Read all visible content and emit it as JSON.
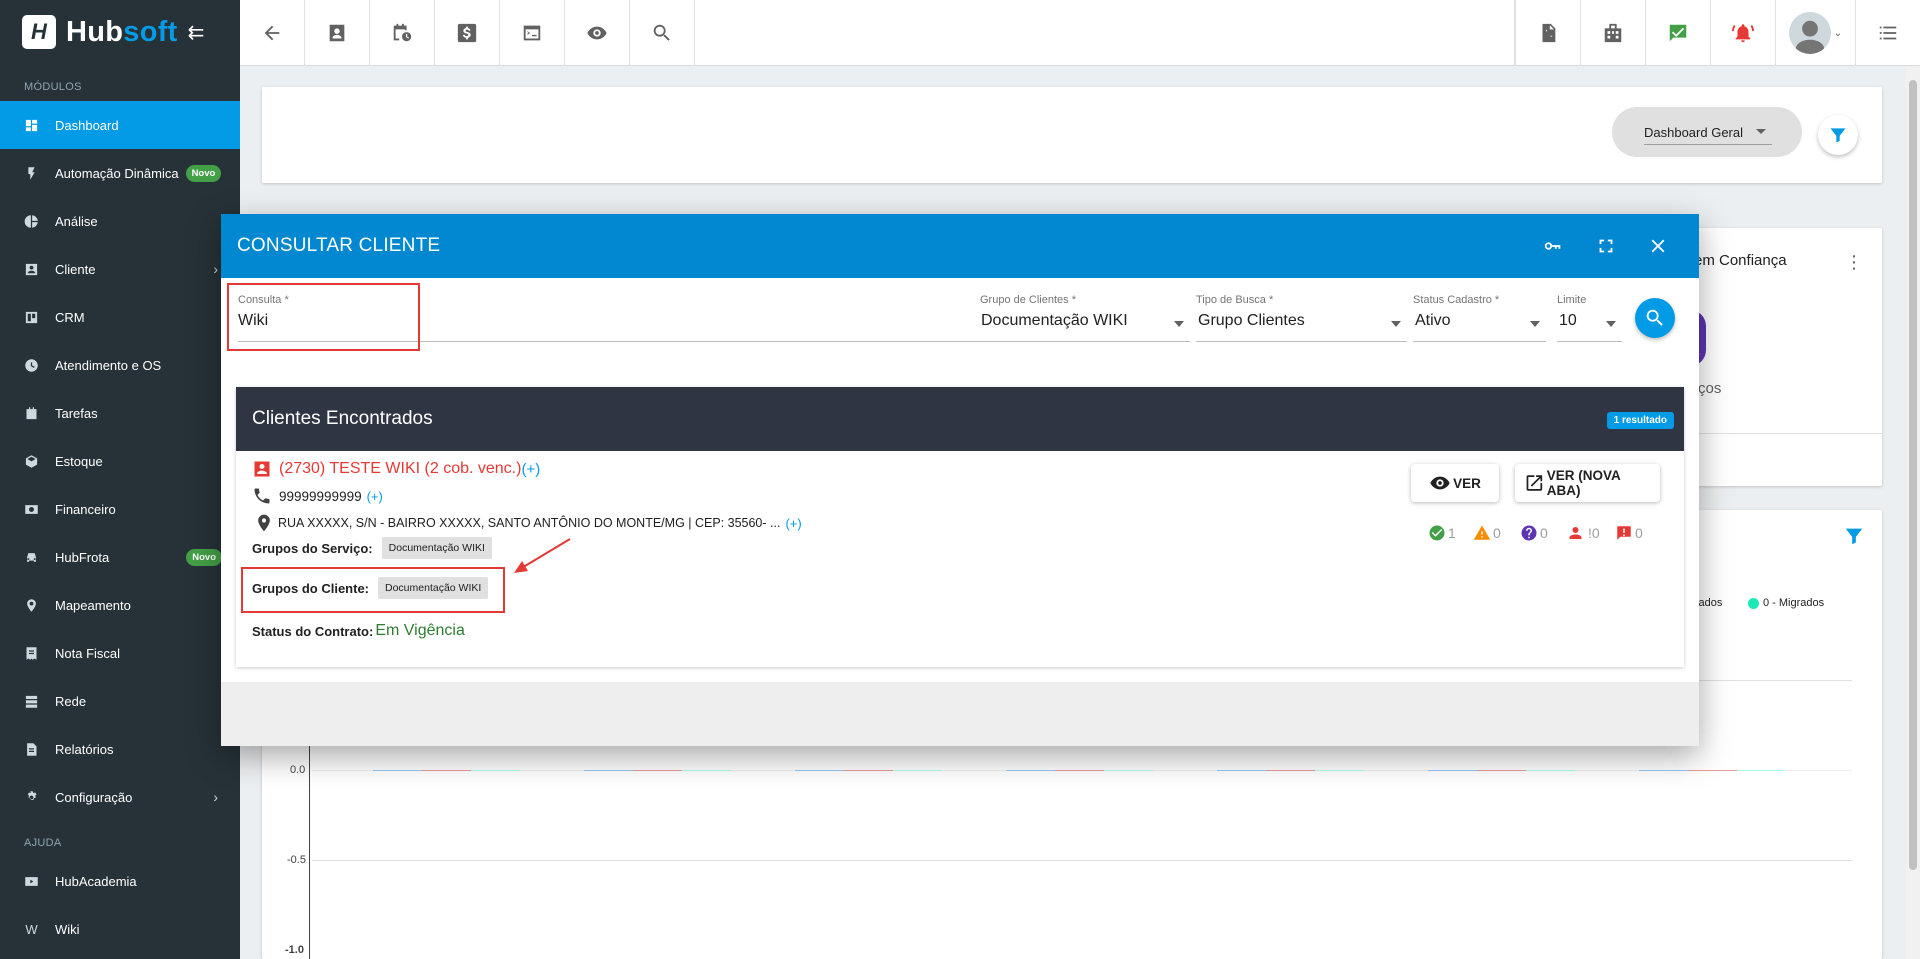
{
  "brand": {
    "name_main": "Hub",
    "name_accent": "soft",
    "logo_letter": "H"
  },
  "sidebar": {
    "section_modules": "MÓDULOS",
    "section_help": "AJUDA",
    "items": [
      {
        "label": "Dashboard",
        "icon": "dashboard-icon",
        "active": true
      },
      {
        "label": "Automação Dinâmica",
        "icon": "automation-icon",
        "badge": "Novo"
      },
      {
        "label": "Análise",
        "icon": "pie-chart-icon"
      },
      {
        "label": "Cliente",
        "icon": "client-icon",
        "has_children": true
      },
      {
        "label": "CRM",
        "icon": "trello-icon"
      },
      {
        "label": "Atendimento e OS",
        "icon": "clock-calendar-icon"
      },
      {
        "label": "Tarefas",
        "icon": "tasks-icon"
      },
      {
        "label": "Estoque",
        "icon": "box-icon"
      },
      {
        "label": "Financeiro",
        "icon": "money-icon"
      },
      {
        "label": "HubFrota",
        "icon": "car-icon",
        "badge": "Novo"
      },
      {
        "label": "Mapeamento",
        "icon": "pin-person-icon"
      },
      {
        "label": "Nota Fiscal",
        "icon": "receipt-icon"
      },
      {
        "label": "Rede",
        "icon": "server-icon"
      },
      {
        "label": "Relatórios",
        "icon": "report-icon"
      },
      {
        "label": "Configuração",
        "icon": "gear-icon",
        "has_children": true
      }
    ],
    "help_items": [
      {
        "label": "HubAcademia",
        "icon": "youtube-icon"
      },
      {
        "label": "Wiki",
        "icon": "wiki-icon"
      }
    ]
  },
  "dashboard": {
    "selector_value": "Dashboard Geral",
    "background_card_title": "em Confiança",
    "background_card_fragment": "ços",
    "legend_left": "elados",
    "legend_right": "0 - Migrados",
    "y_axis_ticks": [
      "0.0",
      "-0.5",
      "-1.0"
    ]
  },
  "modal": {
    "title": "CONSULTAR CLIENTE",
    "consulta_label": "Consulta *",
    "consulta_value": "Wiki",
    "grupo_label": "Grupo de Clientes *",
    "grupo_value": "Documentação WIKI",
    "tipo_label": "Tipo de Busca *",
    "tipo_value": "Grupo Clientes",
    "status_label": "Status Cadastro *",
    "status_value": "Ativo",
    "limite_label": "Limite",
    "limite_value": "10"
  },
  "results": {
    "title": "Clientes Encontrados",
    "count_label": "1 resultado",
    "client": {
      "name": "(2730) TESTE WIKI (2 cob. venc.)",
      "name_plus": "(+)",
      "phone": "99999999999",
      "phone_plus": "(+)",
      "address": "RUA XXXXX, S/N - BAIRRO XXXXX, SANTO ANTÔNIO DO MONTE/MG | CEP: 35560- ...",
      "address_plus": "(+)",
      "service_groups_label": "Grupos do Serviço:",
      "service_groups_chip": "Documentação WIKI",
      "client_groups_label": "Grupos do Cliente:",
      "client_groups_chip": "Documentação WIKI",
      "contract_status_label": "Status do Contrato:",
      "contract_status_value": "Em Vigência"
    },
    "buttons": {
      "view": "VER",
      "view_new_tab": "VER (NOVA ABA)"
    },
    "stats": {
      "ok": "1",
      "warning": "0",
      "question": "0",
      "person": "!0",
      "alert": "0"
    },
    "colors": {
      "ok": "#43a047",
      "warning": "#fb8c00",
      "question": "#5e35b1",
      "person": "#e53935",
      "alert": "#e53935"
    }
  }
}
